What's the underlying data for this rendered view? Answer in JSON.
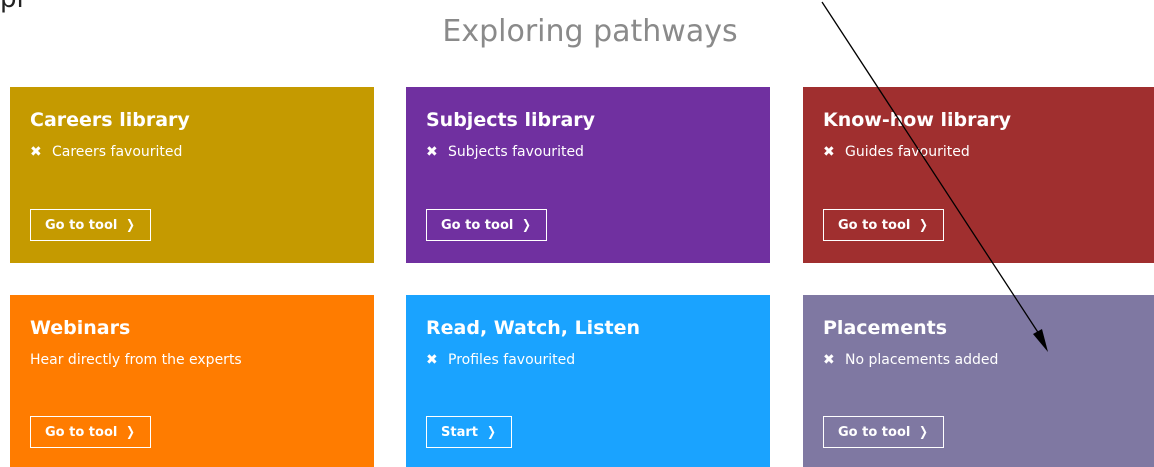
{
  "corner_text": "pl",
  "section_title": "Exploring pathways",
  "cards": [
    {
      "title": "Careers library",
      "subtitle": "Careers favourited",
      "button": "Go to tool",
      "color": "#c59a00"
    },
    {
      "title": "Subjects library",
      "subtitle": "Subjects favourited",
      "button": "Go to tool",
      "color": "#7030a0"
    },
    {
      "title": "Know-how library",
      "subtitle": "Guides favourited",
      "button": "Go to tool",
      "color": "#a02f2f"
    },
    {
      "title": "Webinars",
      "subtitle": "Hear directly from the experts",
      "button": "Go to tool",
      "color": "#ff7c00"
    },
    {
      "title": "Read, Watch, Listen",
      "subtitle": "Profiles favourited",
      "button": "Start",
      "color": "#1aa3ff"
    },
    {
      "title": "Placements",
      "subtitle": "No placements added",
      "button": "Go to tool",
      "color": "#7f78a2"
    }
  ],
  "icons": {
    "status": "close-x-icon",
    "button": "chevron-right-icon",
    "annotation": "annotation-arrow"
  }
}
